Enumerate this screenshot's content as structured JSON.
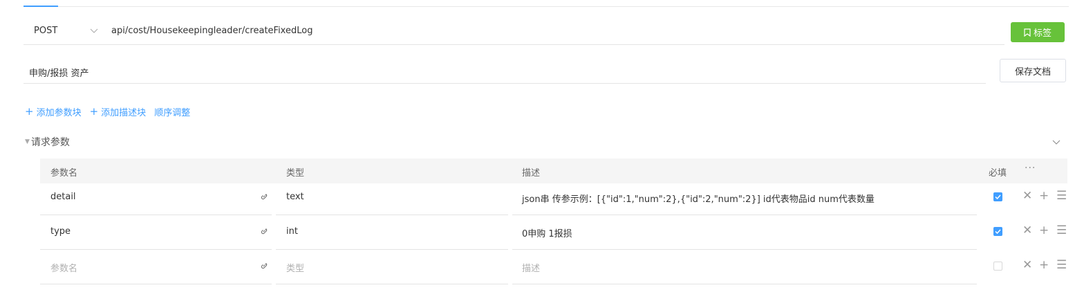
{
  "request": {
    "method": "POST",
    "url": "api/cost/Housekeepingleader/createFixedLog",
    "tag_label": "标签"
  },
  "doc": {
    "title": "申购/报损  资产",
    "save_label": "保存文档"
  },
  "toolbar": {
    "add_param_block": "添加参数块",
    "add_desc_block": "添加描述块",
    "reorder": "顺序调整"
  },
  "section": {
    "title": "请求参数"
  },
  "table": {
    "headers": {
      "name": "参数名",
      "type": "类型",
      "desc": "描述",
      "required": "必填",
      "more": "···"
    },
    "rows": [
      {
        "name": "detail",
        "type": "text",
        "desc": "json串 传参示例：[{\"id\":1,\"num\":2},{\"id\":2,\"num\":2}]    id代表物品id  num代表数量",
        "required": true
      },
      {
        "name": "type",
        "type": "int",
        "desc": "0申购 1报损",
        "required": true
      }
    ],
    "empty_row": {
      "name_placeholder": "参数名",
      "type_placeholder": "类型",
      "desc_placeholder": "描述",
      "required": false
    }
  },
  "icons": {
    "method_dropdown": "chevron-down-icon",
    "tag": "tag-icon",
    "plus": "plus-icon",
    "caret": "caret-down-icon",
    "collapse": "chevron-down-icon",
    "link": "link-icon",
    "delete": "close-icon",
    "add_row": "plus-icon",
    "drag": "menu-icon"
  },
  "colors": {
    "accent": "#409eff",
    "tag_button": "#67c23a"
  }
}
